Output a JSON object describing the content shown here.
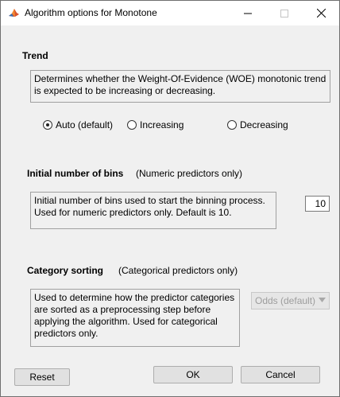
{
  "window": {
    "title": "Algorithm options for Monotone"
  },
  "trend": {
    "heading": "Trend",
    "description": "Determines whether the Weight-Of-Evidence (WOE) monotonic trend\nis expected to be increasing or decreasing.",
    "options": [
      {
        "label": "Auto (default)",
        "selected": true
      },
      {
        "label": "Increasing",
        "selected": false
      },
      {
        "label": "Decreasing",
        "selected": false
      }
    ]
  },
  "bins": {
    "heading": "Initial number of bins",
    "note": "(Numeric predictors only)",
    "description": "Initial number of bins used to start the binning process.\n Used for numeric predictors only. Default is 10.",
    "value": "10"
  },
  "sorting": {
    "heading": "Category sorting",
    "note": "(Categorical predictors only)",
    "description": "Used to determine how the predictor categories\nare sorted as a preprocessing step before\napplying the algorithm. Used for categorical\npredictors only.",
    "selected": "Odds (default)",
    "enabled": false
  },
  "buttons": {
    "reset": "Reset",
    "ok": "OK",
    "cancel": "Cancel"
  },
  "colors": {
    "dialog_bg": "#f0f0f0",
    "titlebar_bg": "#ffffff",
    "disabled_text": "#9d9d9d"
  }
}
